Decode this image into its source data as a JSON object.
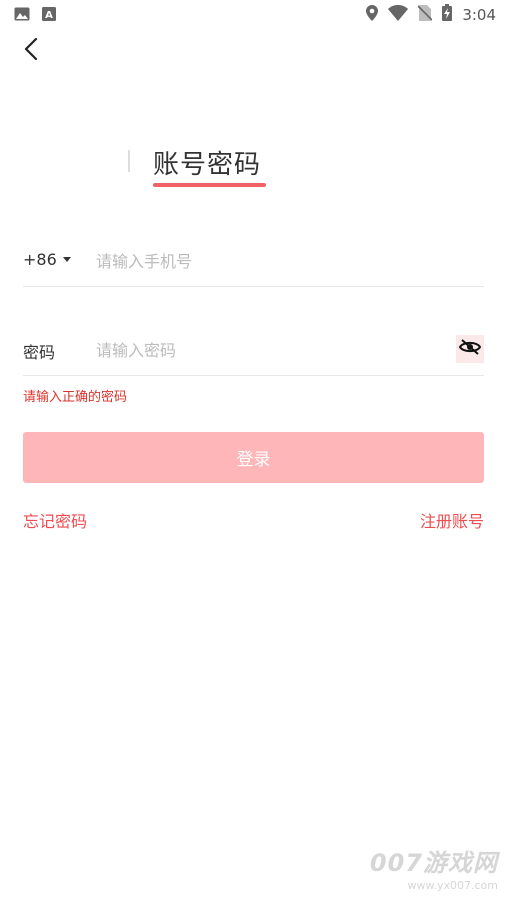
{
  "status_bar": {
    "time": "3:04",
    "left_icons": [
      "image-icon",
      "a-box-icon"
    ],
    "right_icons": [
      "location-icon",
      "wifi-icon",
      "no-sim-icon",
      "battery-charging-icon"
    ]
  },
  "nav": {
    "back_icon": "chevron-left-icon"
  },
  "tab": {
    "title": "账号密码",
    "underline_color": "#f06266"
  },
  "phone": {
    "country_code": "+86",
    "placeholder": "请输入手机号",
    "value": ""
  },
  "password": {
    "label": "密码",
    "placeholder": "请输入密码",
    "value": "",
    "toggle_icon": "eye-off-icon"
  },
  "error": {
    "message": "请输入正确的密码"
  },
  "login": {
    "label": "登录",
    "color": "#ffb6b8"
  },
  "links": {
    "forgot": "忘记密码",
    "register": "注册账号",
    "color": "#ef4c51"
  },
  "watermark": {
    "brand": "007游戏网",
    "url": "www.yx007.com"
  }
}
